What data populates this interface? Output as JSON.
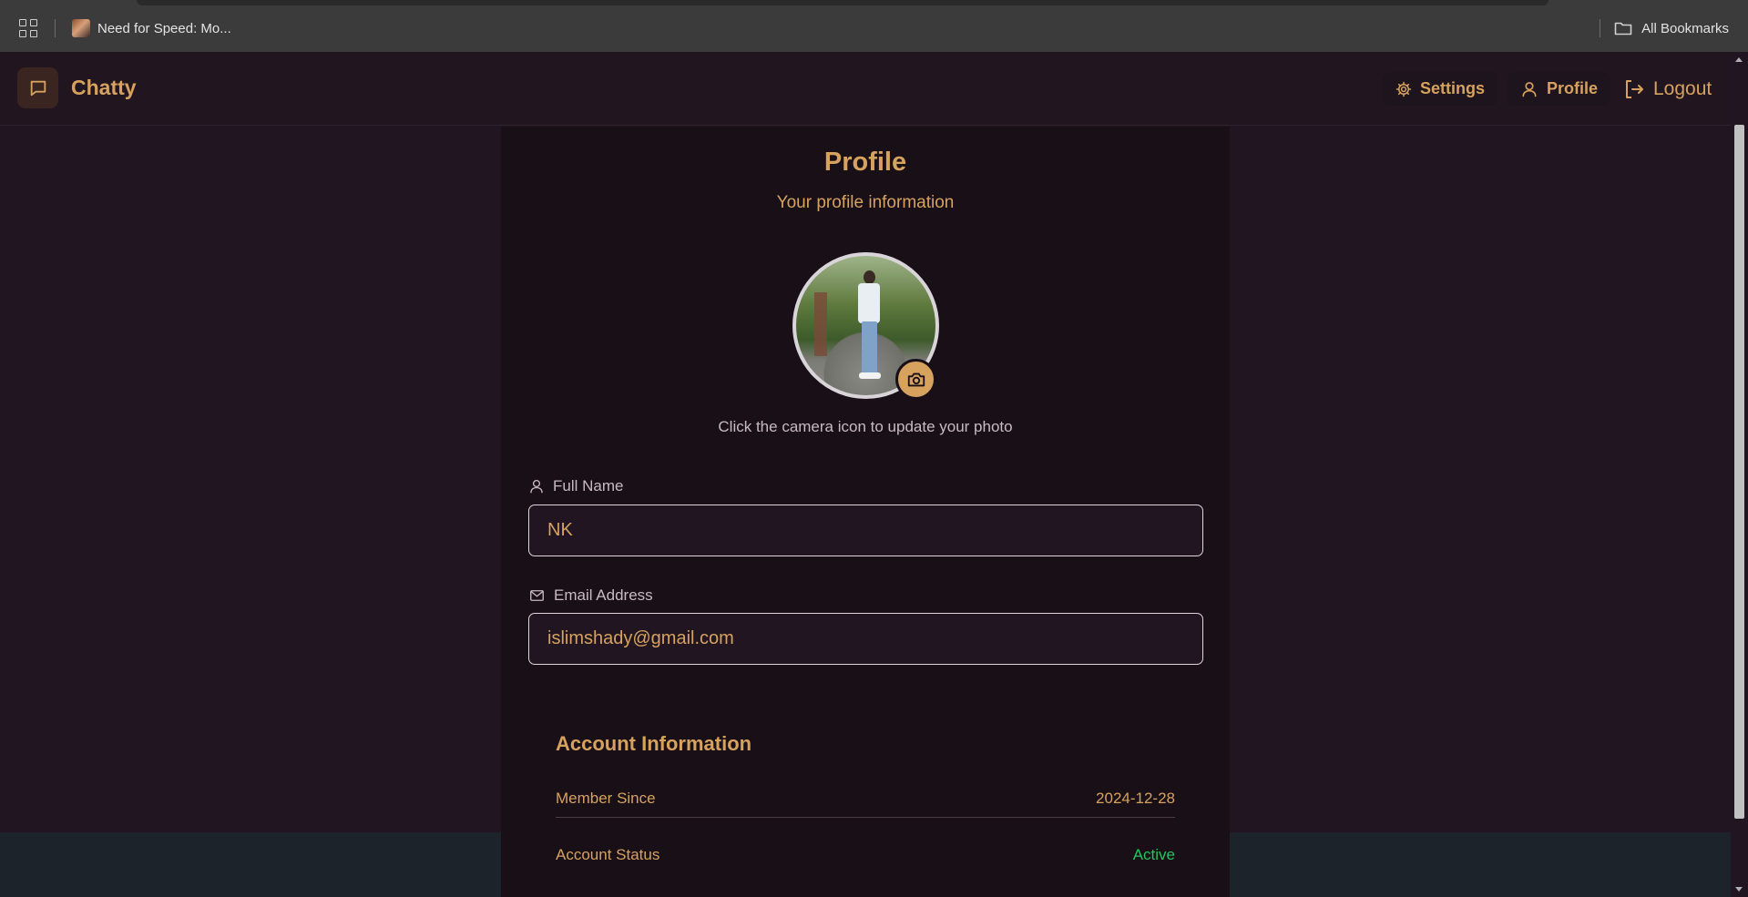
{
  "browser": {
    "bookmark_label": "Need for Speed: Mo...",
    "all_bookmarks_label": "All Bookmarks"
  },
  "navbar": {
    "brand": "Chatty",
    "settings_label": "Settings",
    "profile_label": "Profile",
    "logout_label": "Logout"
  },
  "profile": {
    "title": "Profile",
    "subtitle": "Your profile information",
    "photo_hint": "Click the camera icon to update your photo",
    "full_name_label": "Full Name",
    "full_name_value": "NK",
    "email_label": "Email Address",
    "email_value": "islimshady@gmail.com"
  },
  "account": {
    "title": "Account Information",
    "member_since_label": "Member Since",
    "member_since_value": "2024-12-28",
    "status_label": "Account Status",
    "status_value": "Active"
  },
  "colors": {
    "accent": "#d6a25e",
    "background": "#201520",
    "card": "#180f17",
    "status_active": "#22c55e"
  },
  "icons": {
    "apps": "apps-grid-icon",
    "folder": "folder-icon",
    "brand": "chat-bubble-icon",
    "settings": "gear-icon",
    "profile": "user-icon",
    "logout": "logout-icon",
    "camera": "camera-icon",
    "name": "user-icon",
    "email": "mail-icon"
  }
}
